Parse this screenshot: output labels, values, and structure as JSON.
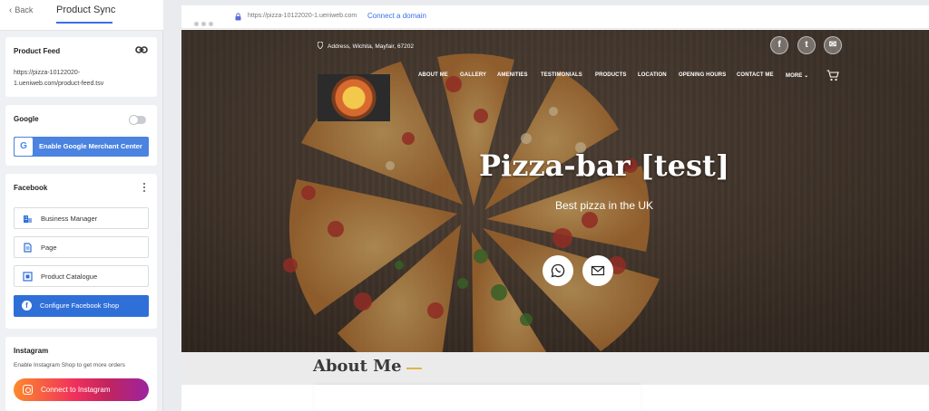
{
  "topbar": {
    "back_label": "Back",
    "title": "Product Sync"
  },
  "product_feed": {
    "title": "Product Feed",
    "url": "https://pizza-10122020-1.ueniweb.com/product-feed.tsv"
  },
  "google": {
    "title": "Google",
    "toggle_on": false,
    "button_label": "Enable Google Merchant Center"
  },
  "facebook": {
    "title": "Facebook",
    "items": [
      {
        "label": "Business Manager",
        "icon": "building-icon"
      },
      {
        "label": "Page",
        "icon": "page-icon"
      },
      {
        "label": "Product Catalogue",
        "icon": "catalogue-icon"
      }
    ],
    "shop_button": "Configure Facebook Shop"
  },
  "instagram": {
    "title": "Instagram",
    "subtitle": "Enable Instagram Shop to get more orders",
    "button_label": "Connect to Instagram"
  },
  "browser": {
    "url": "https://pizza-10122020-1.ueniweb.com",
    "connect_label": "Connect a domain"
  },
  "site": {
    "address": "Address, Wichita, Mayfair, 67202",
    "social": [
      "facebook-icon",
      "twitter-icon",
      "mail-icon"
    ],
    "nav": [
      "ABOUT ME",
      "GALLERY",
      "AMENITIES",
      "TESTIMONIALS",
      "PRODUCTS",
      "LOCATION",
      "OPENING HOURS",
      "CONTACT ME",
      "MORE ⌄"
    ],
    "hero_title": "Pizza-bar [test]",
    "hero_subtitle": "Best pizza in the UK",
    "about_heading": "About Me"
  },
  "colors": {
    "primary_blue": "#2f6fd8",
    "google_blue": "#4a83e0",
    "accent_gold": "#e0b34a"
  }
}
